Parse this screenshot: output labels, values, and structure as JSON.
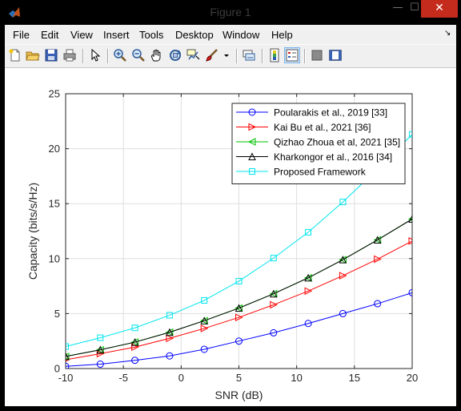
{
  "window": {
    "title": "Figure 1",
    "minimize": "—",
    "maximize": "☐",
    "close": "✕"
  },
  "menubar": {
    "items": [
      "File",
      "Edit",
      "View",
      "Insert",
      "Tools",
      "Desktop",
      "Window",
      "Help"
    ],
    "overflow_arrow": "↘"
  },
  "toolbar": {
    "icons": [
      "new-figure-icon",
      "open-file-icon",
      "save-icon",
      "print-icon",
      "pointer-icon",
      "zoom-in-icon",
      "zoom-out-icon",
      "pan-icon",
      "rotate-3d-icon",
      "data-cursor-icon",
      "brush-icon",
      "brush-dropdown-icon",
      "link-plot-icon",
      "colorbar-icon",
      "legend-icon",
      "hide-plot-tools-icon",
      "show-plot-tools-icon"
    ]
  },
  "chart_data": {
    "type": "line",
    "title": "",
    "xlabel": "SNR (dB)",
    "ylabel": "Capacity (bits/s/Hz)",
    "xlim": [
      -10,
      20
    ],
    "ylim": [
      0,
      25
    ],
    "xticks": [
      "-10",
      "-5",
      "0",
      "5",
      "10",
      "15",
      "20"
    ],
    "yticks": [
      "0",
      "5",
      "10",
      "15",
      "20",
      "25"
    ],
    "grid": true,
    "legend_position": "top-right",
    "x": [
      -10,
      -7,
      -4,
      -1,
      2,
      5,
      8,
      11,
      14,
      17,
      20
    ],
    "series": [
      {
        "name": "Poularakis et al., 2019 [33]",
        "color": "#0000ff",
        "marker": "circle",
        "values": [
          0.2,
          0.4,
          0.75,
          1.15,
          1.75,
          2.5,
          3.25,
          4.1,
          5.0,
          5.9,
          6.9
        ]
      },
      {
        "name": "Kai Bu et al., 2021 [36]",
        "color": "#ff0000",
        "marker": "triangle-right",
        "values": [
          0.8,
          1.35,
          1.95,
          2.75,
          3.65,
          4.65,
          5.8,
          7.05,
          8.45,
          9.95,
          11.6
        ]
      },
      {
        "name": "Qizhao Zhoua et al, 2021 [35]",
        "color": "#00c000",
        "marker": "triangle-left",
        "values": [
          1.1,
          1.7,
          2.4,
          3.3,
          4.35,
          5.5,
          6.8,
          8.25,
          9.9,
          11.7,
          13.6
        ]
      },
      {
        "name": "Kharkongor et al., 2016 [34]",
        "color": "#000000",
        "marker": "triangle-up",
        "values": [
          1.1,
          1.7,
          2.4,
          3.3,
          4.35,
          5.5,
          6.8,
          8.25,
          9.9,
          11.7,
          13.6
        ]
      },
      {
        "name": "Proposed Framework",
        "color": "#00e5ee",
        "marker": "square",
        "values": [
          2.0,
          2.8,
          3.7,
          4.85,
          6.2,
          7.95,
          10.05,
          12.4,
          15.15,
          18.15,
          21.3
        ]
      }
    ]
  }
}
